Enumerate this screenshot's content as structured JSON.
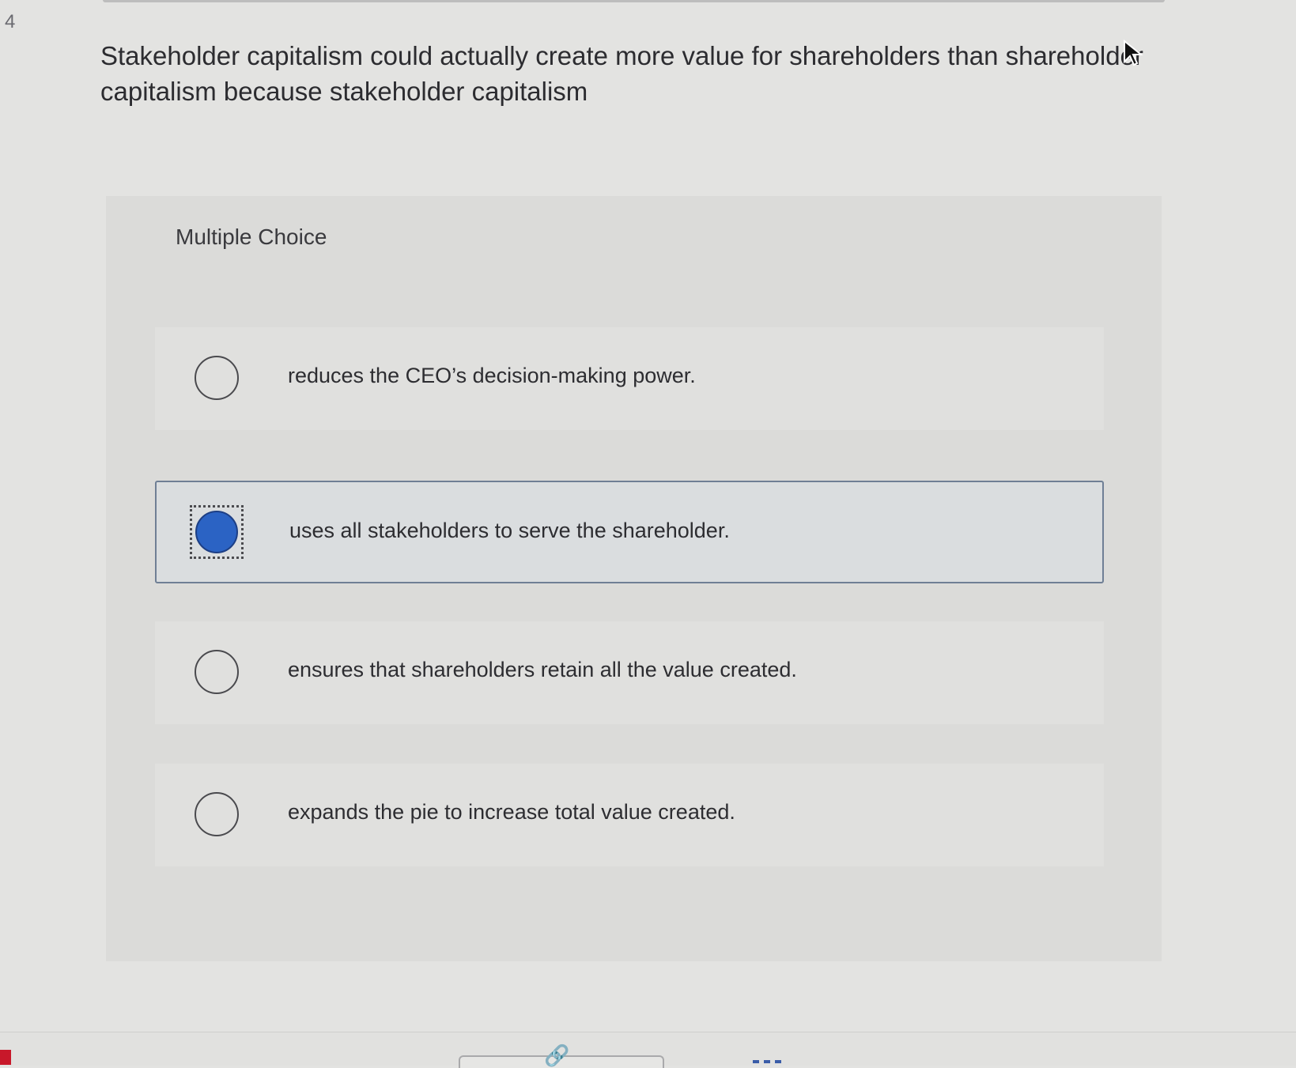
{
  "question": {
    "number": "4",
    "text": "Stakeholder capitalism could actually create more value for shareholders than shareholder capitalism because stakeholder capitalism"
  },
  "multiple_choice": {
    "label": "Multiple Choice",
    "selected_index": 1,
    "options": [
      {
        "text": "reduces the CEO’s decision-making power."
      },
      {
        "text": "uses all stakeholders to serve the shareholder."
      },
      {
        "text": "ensures that shareholders retain all the value created."
      },
      {
        "text": "expands the pie to increase total value created."
      }
    ]
  },
  "colors": {
    "selected_radio": "#2b63c4",
    "selected_border": "#6f7f95"
  },
  "icons": {
    "bottom_left": "link-icon",
    "bottom_right": "dashes-icon",
    "pointer": "cursor-icon"
  }
}
